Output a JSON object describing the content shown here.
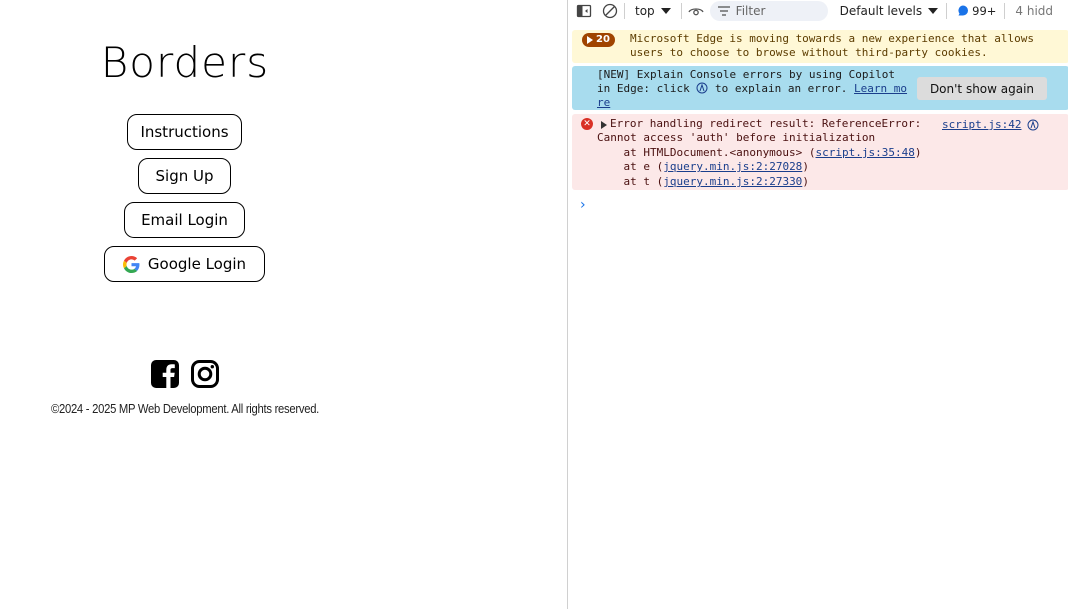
{
  "page": {
    "title": "Borders",
    "buttons": {
      "instructions": "Instructions",
      "signup": "Sign Up",
      "email_login": "Email Login",
      "google_login": "Google Login"
    },
    "social_icons": [
      "facebook-icon",
      "instagram-icon"
    ],
    "footer": "©2024 - 2025 MP Web Development. All rights reserved."
  },
  "devtools": {
    "toolbar": {
      "context": "top",
      "filter_placeholder": "Filter",
      "levels": "Default levels",
      "issues": "99+",
      "hidden": "4 hidd"
    },
    "warning": {
      "count": "20",
      "text": "Microsoft Edge is moving towards a new experience that allows users to choose to browse without third-party cookies."
    },
    "info": {
      "text_1": "[NEW] Explain Console errors by using Copilot",
      "text_2a": "in Edge: click",
      "text_2b": "to explain an error.",
      "link": "Learn mo",
      "link_2": "re",
      "dismiss": "Don't show again"
    },
    "error": {
      "line_1": "Error handling redirect result: ReferenceError:",
      "line_2": "Cannot access 'auth' before initialization",
      "line_3_prefix": "    at HTMLDocument.<anonymous> (",
      "line_3_link": "script.js:35:48",
      "line_3_suffix": ")",
      "line_4_prefix": "    at e (",
      "line_4_link": "jquery.min.js:2:27028",
      "line_4_suffix": ")",
      "line_5_prefix": "    at t (",
      "line_5_link": "jquery.min.js:2:27330",
      "line_5_suffix": ")",
      "source": "script.js:42"
    },
    "prompt": "›"
  },
  "colors": {
    "warning_bg": "#fff8d6",
    "info_bg": "#a8dcee",
    "error_bg": "#fce8e8",
    "error_red": "#d93025",
    "link_blue": "#1a3e8c"
  }
}
